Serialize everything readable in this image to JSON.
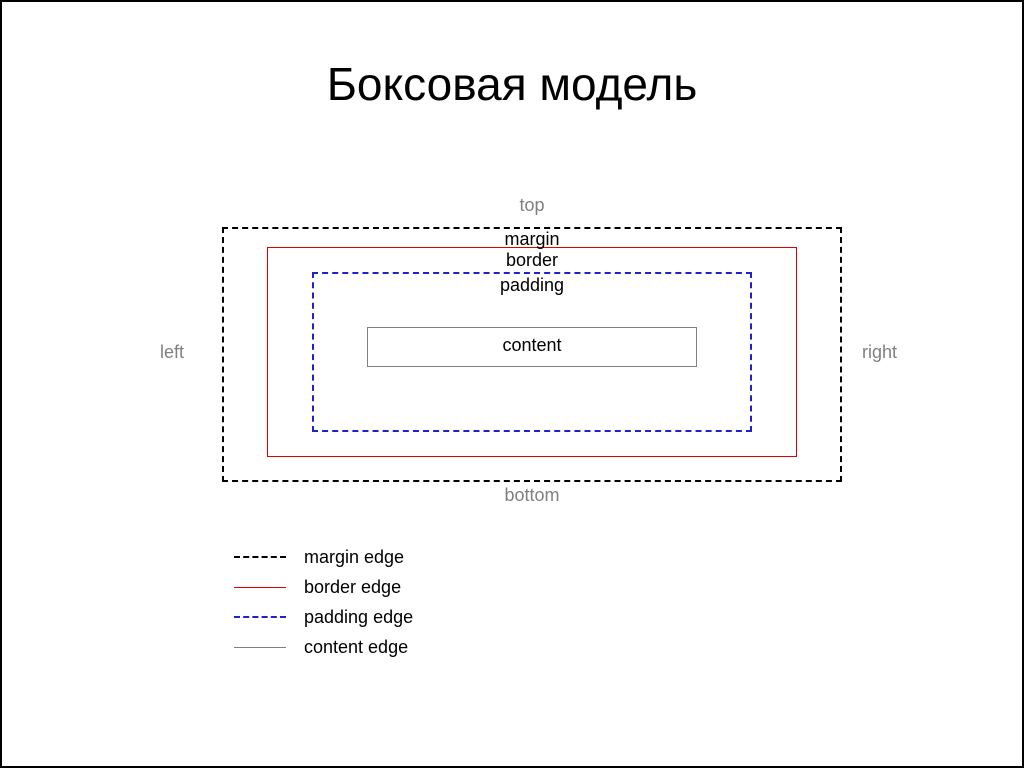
{
  "title": "Боксовая модель",
  "sides": {
    "top": "top",
    "bottom": "bottom",
    "left": "left",
    "right": "right"
  },
  "layers": {
    "margin": "margin",
    "border": "border",
    "padding": "padding",
    "content": "content"
  },
  "legend": {
    "margin": "margin edge",
    "border": "border edge",
    "padding": "padding edge",
    "content": "content edge"
  }
}
